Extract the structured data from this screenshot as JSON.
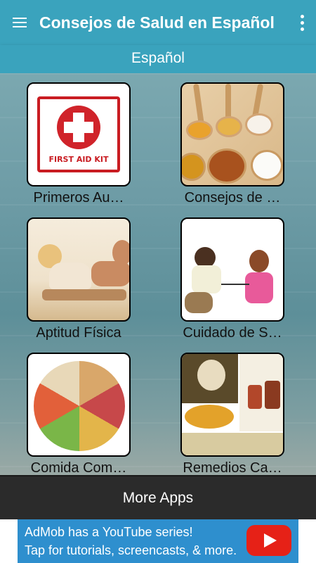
{
  "appbar": {
    "title": "Consejos de Salud en Español",
    "menu_icon": "hamburger-menu-icon",
    "overflow_icon": "more-vert-icon"
  },
  "language_bar": {
    "label": "Español"
  },
  "tiles": [
    {
      "label": "Primeros Au…",
      "image": "first-aid-kit"
    },
    {
      "label": "Consejos de …",
      "image": "spice-spoons"
    },
    {
      "label": "Aptitud Física",
      "image": "fitness-couple"
    },
    {
      "label": "Cuidado de S…",
      "image": "children-stethoscope"
    },
    {
      "label": "Comida Com…",
      "image": "food-groups-plate"
    },
    {
      "label": "Remedios Ca…",
      "image": "home-remedies"
    }
  ],
  "first_aid_text": "FIRST AID KIT",
  "bottom_button": {
    "label": "More Apps"
  },
  "ad": {
    "line1": "AdMob has a YouTube series!",
    "line2": "Tap for tutorials, screencasts, & more.",
    "icon": "youtube-play-icon"
  },
  "colors": {
    "primary": "#3aa3bd",
    "dark_bar": "#2b2b2b",
    "ad_blue": "#2e8fce",
    "youtube_red": "#e62117"
  }
}
